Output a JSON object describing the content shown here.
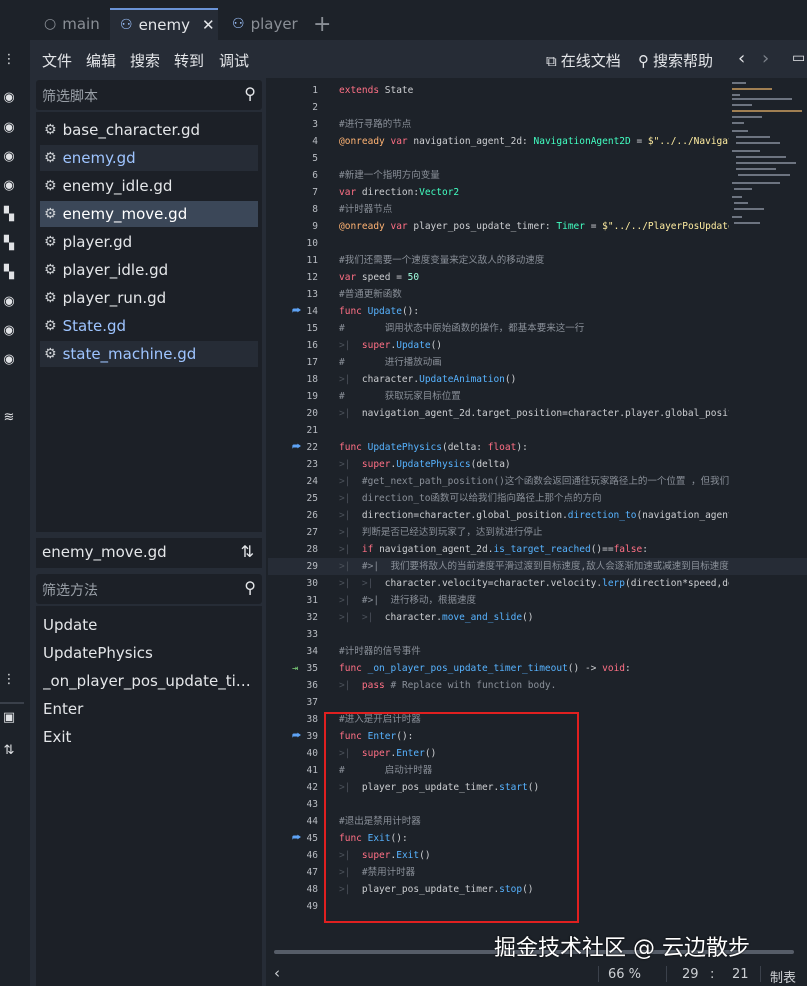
{
  "tabs": [
    {
      "label": "main",
      "icon": "circle-icon"
    },
    {
      "label": "enemy",
      "icon": "scene-icon",
      "active": true
    },
    {
      "label": "player",
      "icon": "scene-icon"
    }
  ],
  "menu": {
    "file": "文件",
    "edit": "编辑",
    "search": "搜索",
    "goto": "转到",
    "debug": "调试",
    "online_docs": "在线文档",
    "search_help": "搜索帮助"
  },
  "script_filter": {
    "placeholder": "筛选脚本"
  },
  "scripts": [
    {
      "name": "base_character.gd",
      "color": "#e4e6e9"
    },
    {
      "name": "enemy.gd",
      "color": "#9ec4ff"
    },
    {
      "name": "enemy_idle.gd",
      "color": "#e4e6e9"
    },
    {
      "name": "enemy_move.gd",
      "color": "#ffffff"
    },
    {
      "name": "player.gd",
      "color": "#e4e6e9"
    },
    {
      "name": "player_idle.gd",
      "color": "#e4e6e9"
    },
    {
      "name": "player_run.gd",
      "color": "#e4e6e9"
    },
    {
      "name": "State.gd",
      "color": "#9ec4ff"
    },
    {
      "name": "state_machine.gd",
      "color": "#9ec4ff"
    }
  ],
  "current_script": "enemy_move.gd",
  "method_filter": {
    "placeholder": "筛选方法"
  },
  "methods": [
    "Update",
    "UpdatePhysics",
    "_on_player_pos_update_timer_timeout",
    "Enter",
    "Exit"
  ],
  "status": {
    "zoom": "66 %",
    "line": "29",
    "col": "21",
    "indent": "制表符"
  },
  "watermark": "掘金技术社区 @ 云边散步"
}
